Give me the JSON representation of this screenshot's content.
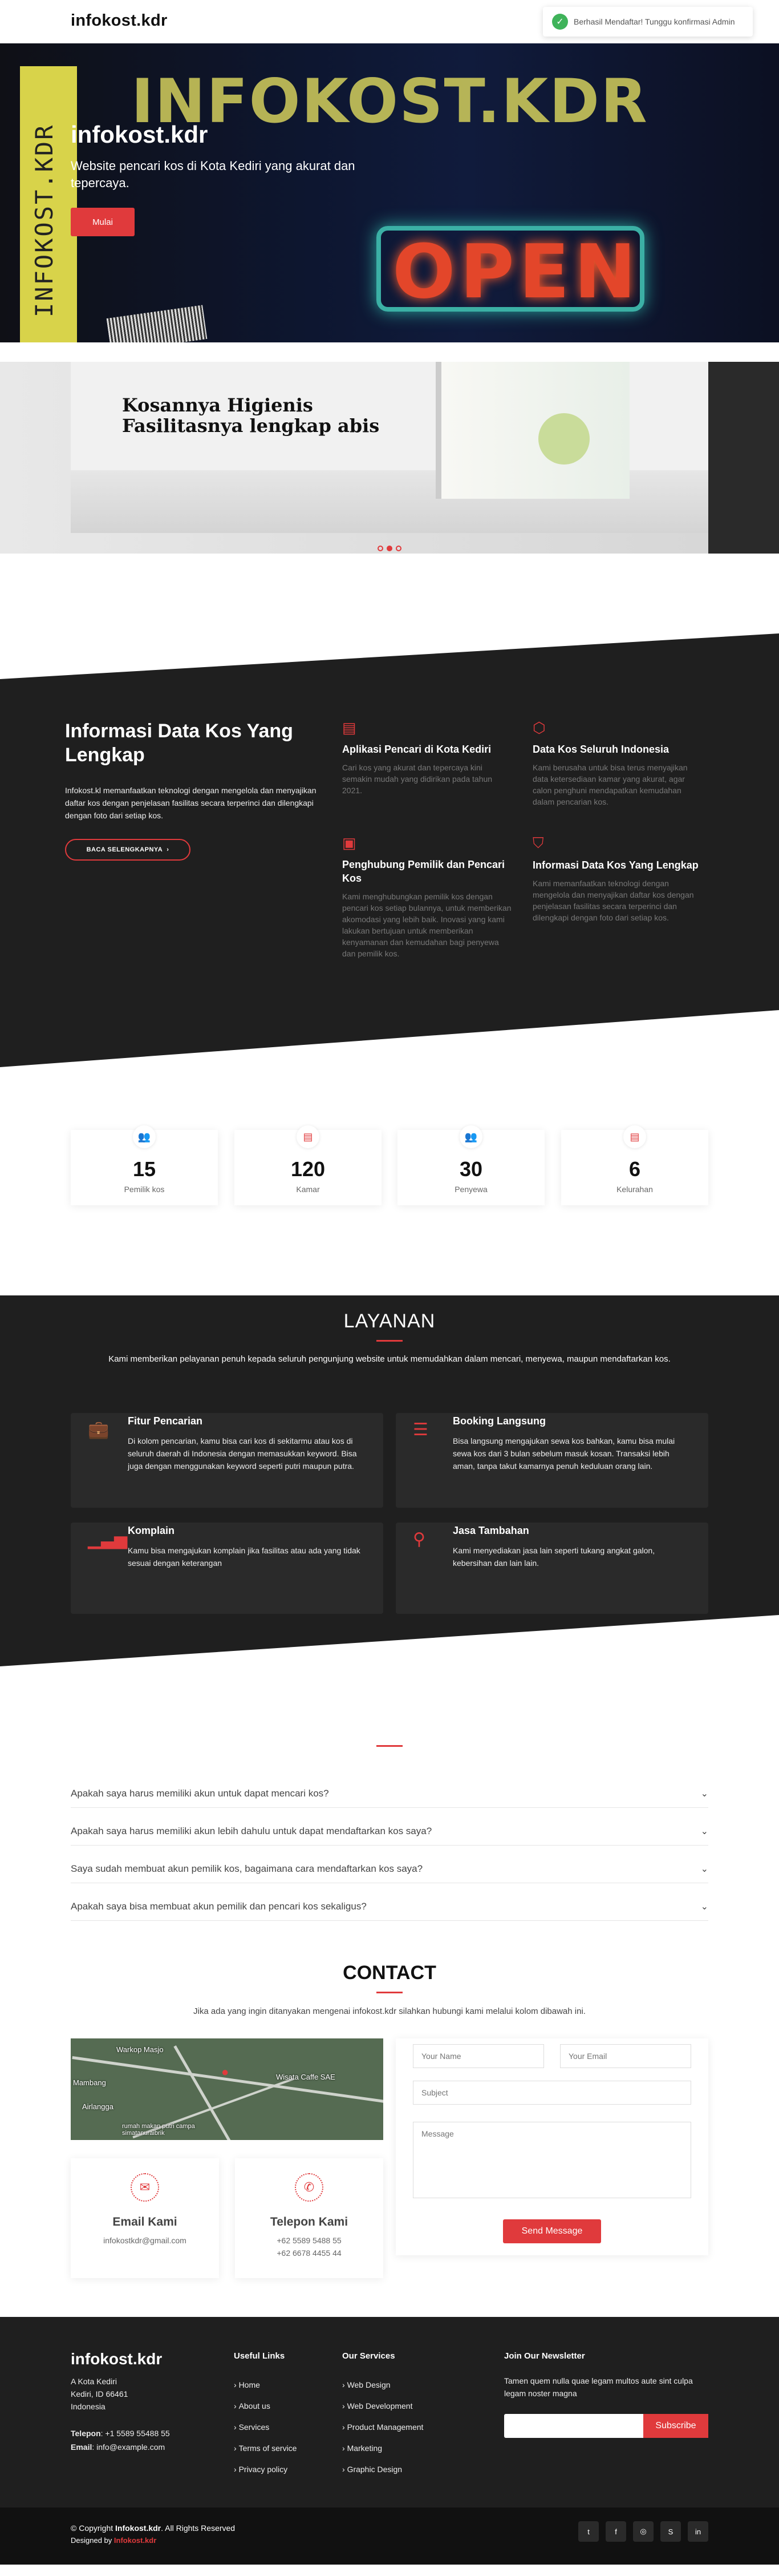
{
  "header": {
    "logo_text": "infokost",
    "logo_suffix": ".kdr",
    "logo_dot": "."
  },
  "toast": {
    "message": "Berhasil Mendaftar! Tunggu konfirmasi Admin"
  },
  "hero": {
    "brand_image_text": "INFOKOST.KDR",
    "side_text": "INFOKOST.KDR",
    "sign_text": "OPEN",
    "title": "infokost.kdr",
    "subtitle": "Website pencari kos di Kota Kediri yang akurat dan tepercaya.",
    "button": "Mulai"
  },
  "slider": {
    "heading_line1": "Kosannya Higienis",
    "heading_line2": "Fasilitasnya lengkap abis",
    "active_dot": 2
  },
  "about": {
    "title": "Informasi Data Kos Yang Lengkap",
    "text": "Infokost.kl memanfaatkan teknologi dengan mengelola dan menyajikan daftar kos dengan penjelasan fasilitas secara terperinci dan dilengkapi dengan foto dari setiap kos.",
    "read_more": "BACA SELENGKAPNYA",
    "features": [
      {
        "icon": "receipt-icon",
        "title": "Aplikasi Pencari di Kota Kediri",
        "text": "Cari kos yang akurat dan tepercaya kini semakin mudah yang didirikan pada tahun 2021."
      },
      {
        "icon": "cube-icon",
        "title": "Data Kos Seluruh Indonesia",
        "text": "Kami berusaha untuk bisa terus menyajikan data ketersediaan kamar yang akurat, agar calon penghuni mendapatkan kemudahan dalam pencarian kos."
      },
      {
        "icon": "images-icon",
        "title": "Penghubung Pemilik dan Pencari Kos",
        "text": "Kami menghubungkan pemilik kos dengan pencari kos setiap bulannya, untuk memberikan akomodasi yang lebih baik. Inovasi yang kami lakukan bertujuan untuk memberikan kenyamanan dan kemudahan bagi penyewa dan pemilik kos."
      },
      {
        "icon": "shield-icon",
        "title": "Informasi Data Kos Yang Lengkap",
        "text": "Kami memanfaatkan teknologi dengan mengelola dan menyajikan daftar kos dengan penjelasan fasilitas secara terperinci dan dilengkapi dengan foto dari setiap kos."
      }
    ]
  },
  "counts": [
    {
      "icon": "people-icon",
      "value": "15",
      "label": "Pemilik kos"
    },
    {
      "icon": "document-icon",
      "value": "120",
      "label": "Kamar"
    },
    {
      "icon": "people-icon",
      "value": "30",
      "label": "Penyewa"
    },
    {
      "icon": "document-icon",
      "value": "6",
      "label": "Kelurahan"
    }
  ],
  "services": {
    "title": "LAYANAN",
    "desc": "Kami memberikan pelayanan penuh kepada seluruh pengunjung website untuk memudahkan dalam mencari, menyewa, maupun mendaftarkan kos.",
    "items": [
      {
        "icon": "briefcase-icon",
        "title": "Fitur Pencarian",
        "text": "Di kolom pencarian, kamu bisa cari kos di sekitarmu atau kos di seluruh daerah di Indonesia dengan memasukkan keyword. Bisa juga dengan menggunakan keyword seperti putri maupun putra."
      },
      {
        "icon": "card-list-icon",
        "title": "Booking Langsung",
        "text": "Bisa langsung mengajukan sewa kos bahkan, kamu bisa mulai sewa kos dari 3 bulan sebelum masuk kosan. Transaksi lebih aman, tanpa takut kamarnya penuh keduluan orang lain."
      },
      {
        "icon": "bar-chart-icon",
        "title": "Komplain",
        "text": "Kamu bisa mengajukan komplain jika fasilitas atau ada yang tidak sesuai dengan keterangan"
      },
      {
        "icon": "binoculars-icon",
        "title": "Jasa Tambahan",
        "text": "Kami menyediakan jasa lain seperti tukang angkat galon, kebersihan dan lain lain."
      }
    ]
  },
  "faq": [
    "Apakah saya harus memiliki akun untuk dapat mencari kos?",
    "Apakah saya harus memiliki akun lebih dahulu untuk dapat mendaftarkan kos saya?",
    "Saya sudah membuat akun pemilik kos, bagaimana cara mendaftarkan kos saya?",
    "Apakah saya bisa membuat akun pemilik dan pencari kos sekaligus?"
  ],
  "contact": {
    "title": "CONTACT",
    "desc": "Jika ada yang ingin ditanyakan mengenai infokost.kdr silahkan hubungi kami melalui kolom dibawah ini.",
    "map_labels": [
      "Warkop Masjo",
      "Wisata Caffe SAE",
      "Mambang",
      "Airlangga",
      "rumah makan putri campa simatanuraibrik"
    ],
    "email_title": "Email Kami",
    "email": "infokostkdr@gmail.com",
    "phone_title": "Telepon Kami",
    "phones": [
      "+62 5589 5488 55",
      "+62 6678 4455 44"
    ],
    "placeholders": {
      "name": "Your Name",
      "email": "Your Email",
      "subject": "Subject",
      "message": "Message"
    },
    "send": "Send Message"
  },
  "footer": {
    "logo": "infokost.kdr",
    "address": [
      "A Kota Kediri",
      "Kediri, ID 66461",
      "Indonesia"
    ],
    "phone_label": "Telepon",
    "phone": ": +1 5589 55488 55",
    "email_label": "Email",
    "email": ": info@example.com",
    "useful_title": "Useful Links",
    "useful": [
      "Home",
      "About us",
      "Services",
      "Terms of service",
      "Privacy policy"
    ],
    "services_title": "Our Services",
    "services": [
      "Web Design",
      "Web Development",
      "Product Management",
      "Marketing",
      "Graphic Design"
    ],
    "newsletter_title": "Join Our Newsletter",
    "newsletter_text": "Tamen quem nulla quae legam multos aute sint culpa legam noster magna",
    "subscribe": "Subscribe"
  },
  "copyright": {
    "prefix": "© Copyright ",
    "brand": "Infokost.kdr",
    "suffix": ". All Rights Reserved",
    "designed": "Designed by ",
    "designer": "Infokost.kdr"
  },
  "social": [
    "twitter-icon",
    "facebook-icon",
    "instagram-icon",
    "skype-icon",
    "linkedin-icon"
  ],
  "colors": {
    "accent": "#e03a3c",
    "dark": "#1f1f1f"
  }
}
